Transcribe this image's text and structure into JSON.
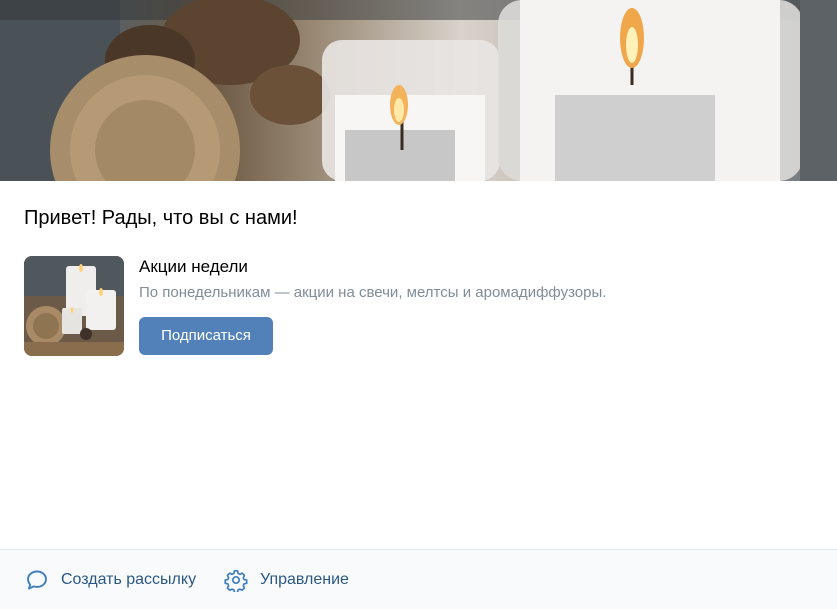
{
  "greeting": "Привет! Рады, что вы с нами!",
  "subscription": {
    "title": "Акции недели",
    "description": "По понедельникам — акции на свечи, мелтсы и аромадиффузоры.",
    "button_label": "Подписаться"
  },
  "footer": {
    "create_label": "Создать рассылку",
    "manage_label": "Управление"
  },
  "icons": {
    "create": "chat-bubble-icon",
    "manage": "gear-icon"
  },
  "colors": {
    "accent_button": "#5181b8",
    "link": "#2a5885",
    "muted_text": "#818c99",
    "footer_bg": "#f9fafb"
  }
}
